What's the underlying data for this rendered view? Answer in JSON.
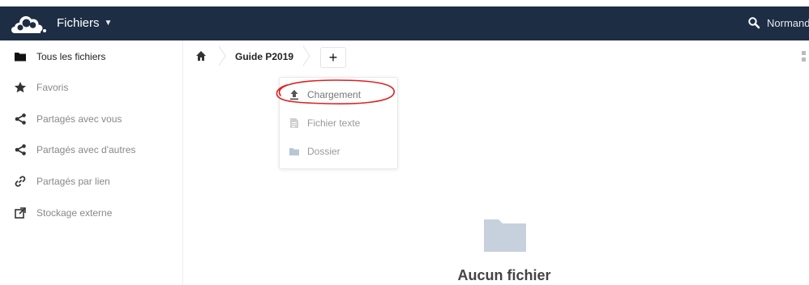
{
  "header": {
    "app_title": "Fichiers",
    "user_name": "Normand",
    "background_color": "#1d2d44"
  },
  "sidebar": {
    "items": [
      {
        "label": "Tous les fichiers",
        "icon": "folder-icon",
        "active": true
      },
      {
        "label": "Favoris",
        "icon": "star-icon"
      },
      {
        "label": "Partagés avec vous",
        "icon": "share-icon"
      },
      {
        "label": "Partagés avec d'autres",
        "icon": "share-icon"
      },
      {
        "label": "Partagés par lien",
        "icon": "link-icon"
      },
      {
        "label": "Stockage externe",
        "icon": "external-storage-icon"
      }
    ]
  },
  "breadcrumb": {
    "folder": "Guide P2019",
    "new_button_label": "+"
  },
  "new_menu": {
    "items": [
      {
        "label": "Chargement",
        "icon": "upload-icon"
      },
      {
        "label": "Fichier texte",
        "icon": "text-file-icon"
      },
      {
        "label": "Dossier",
        "icon": "folder-icon"
      }
    ]
  },
  "empty": {
    "title": "Aucun fichier"
  },
  "colors": {
    "annotation": "#e02020",
    "folder_icon": "#c7d1de"
  }
}
